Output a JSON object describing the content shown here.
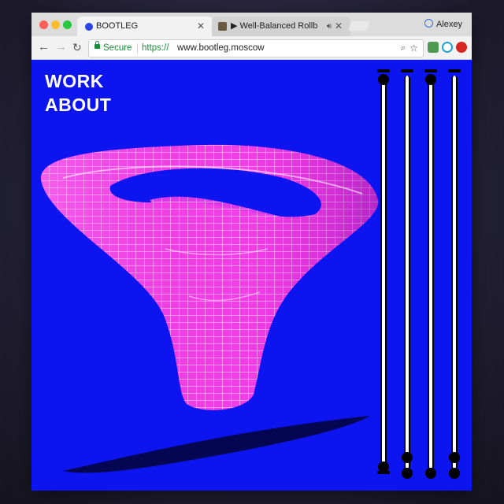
{
  "browser": {
    "tabs": [
      {
        "title": "BOOTLEG",
        "active": true
      },
      {
        "title": "▶ Well-Balanced Rollback |",
        "active": false
      }
    ],
    "user_name": "Alexey",
    "address_bar": {
      "secure_label": "Secure",
      "scheme": "https://",
      "host": "www.bootleg.moscow"
    },
    "accent_colors": {
      "page_background": "#0c14f0",
      "object": "#ff33e9",
      "secure_green": "#1a8c3a"
    }
  },
  "site": {
    "nav": [
      {
        "label": "WORK"
      },
      {
        "label": "ABOUT"
      }
    ]
  },
  "sliders_count_note": "",
  "icons": [
    "close-icon",
    "speaker-icon",
    "back-arrow-icon",
    "forward-arrow-icon",
    "reload-icon",
    "lock-icon",
    "search-icon",
    "star-icon",
    "user-icon"
  ]
}
